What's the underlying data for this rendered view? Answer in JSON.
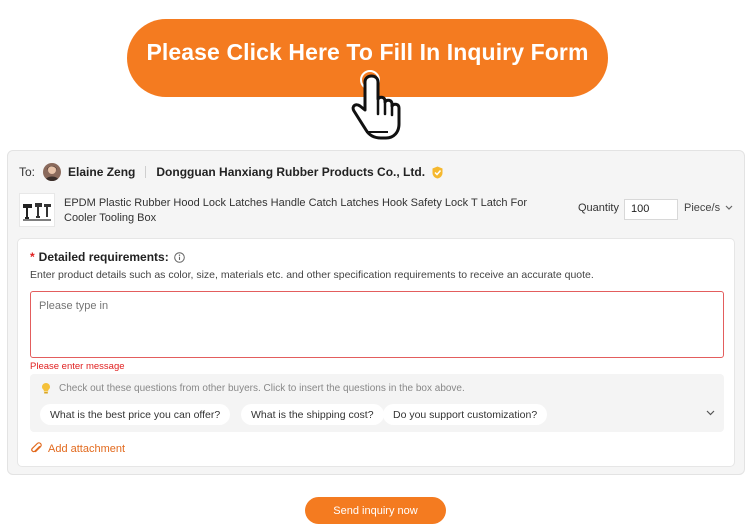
{
  "banner": {
    "text": "Please Click Here To Fill In Inquiry Form",
    "icon": "pointing-hand-icon"
  },
  "recipient": {
    "to_label": "To:",
    "contact_name": "Elaine Zeng",
    "company": "Dongguan Hanxiang Rubber Products Co., Ltd.",
    "badge_icon": "verified-badge-icon"
  },
  "product": {
    "title": "EPDM Plastic Rubber Hood Lock Latches Handle Catch Latches Hook Safety Lock T Latch For Cooler Tooling Box",
    "quantity_label": "Quantity",
    "quantity_value": "100",
    "unit": "Piece/s"
  },
  "requirements": {
    "label": "Detailed requirements:",
    "required_mark": "*",
    "description": "Enter product details such as color, size, materials etc. and other specification requirements to receive an accurate quote.",
    "placeholder": "Please type in",
    "error": "Please enter message"
  },
  "suggestions": {
    "hint": "Check out these questions from other buyers. Click to insert the questions in the box above.",
    "chips": [
      "What is the best price you can offer?",
      "What is the shipping cost?",
      "Do you support customization?"
    ]
  },
  "attachment_label": "Add attachment",
  "send_label": "Send inquiry now",
  "colors": {
    "accent": "#f47b20",
    "error": "#e02020",
    "link": "#e26a1e"
  }
}
